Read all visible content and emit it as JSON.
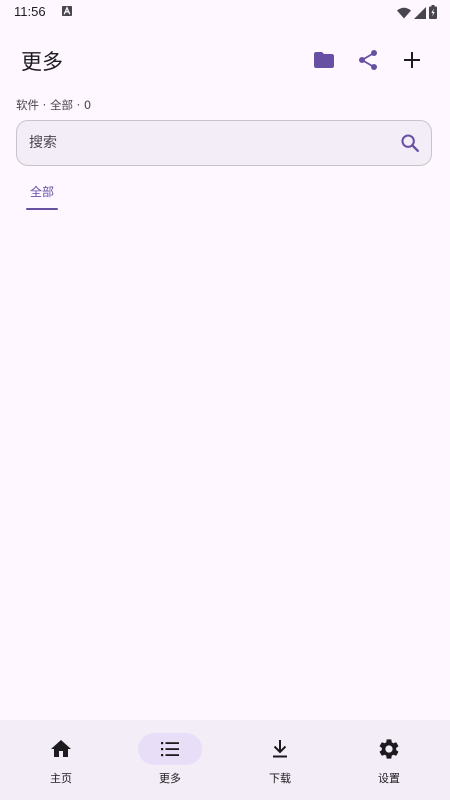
{
  "status_bar": {
    "time": "11:56",
    "notification_icon": "a-icon",
    "indicators": [
      "wifi-icon",
      "signal-icon",
      "battery-charging-icon"
    ]
  },
  "app_bar": {
    "title": "更多",
    "actions": [
      "folder-icon",
      "share-icon",
      "add-icon"
    ]
  },
  "subtitle": "软件 · 全部 · 0",
  "search": {
    "placeholder": "搜索",
    "value": ""
  },
  "tabs": [
    {
      "label": "全部",
      "selected": true
    }
  ],
  "bottom_nav": {
    "items": [
      {
        "label": "主页",
        "icon": "home-icon",
        "selected": false
      },
      {
        "label": "更多",
        "icon": "list-icon",
        "selected": true
      },
      {
        "label": "下载",
        "icon": "download-icon",
        "selected": false
      },
      {
        "label": "设置",
        "icon": "settings-icon",
        "selected": false
      }
    ]
  },
  "colors": {
    "background": "#FEF7FF",
    "accent": "#6750A4",
    "nav_background": "#F3EDF7",
    "nav_selected_pill": "#E8DEF8"
  }
}
